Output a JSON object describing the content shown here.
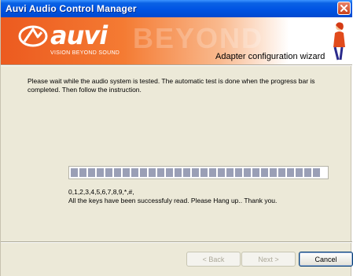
{
  "window": {
    "title": "Auvi Audio Control Manager"
  },
  "banner": {
    "logo_text": "auvi",
    "logo_tagline": "VISION BEYOND SOUND",
    "ghost_text": "BEYOND",
    "wizard_title": "Adapter configuration wizard"
  },
  "body": {
    "message": "Please wait while the audio system is tested. The automatic test is done when the progress bar is completed. Then follow the instruction.",
    "keys": "0,1,2,3,4,5,6,7,8,9,*,#,",
    "status": "All the keys have been successfuly read. Please Hang up.. Thank you."
  },
  "progress": {
    "fraction": 1.0,
    "segments": 29
  },
  "buttons": {
    "back": "< Back",
    "next": "Next >",
    "cancel": "Cancel"
  },
  "colors": {
    "accent": "#0054e3",
    "banner_orange": "#ec5a1f",
    "progress_segment": "#9a9fb6"
  }
}
